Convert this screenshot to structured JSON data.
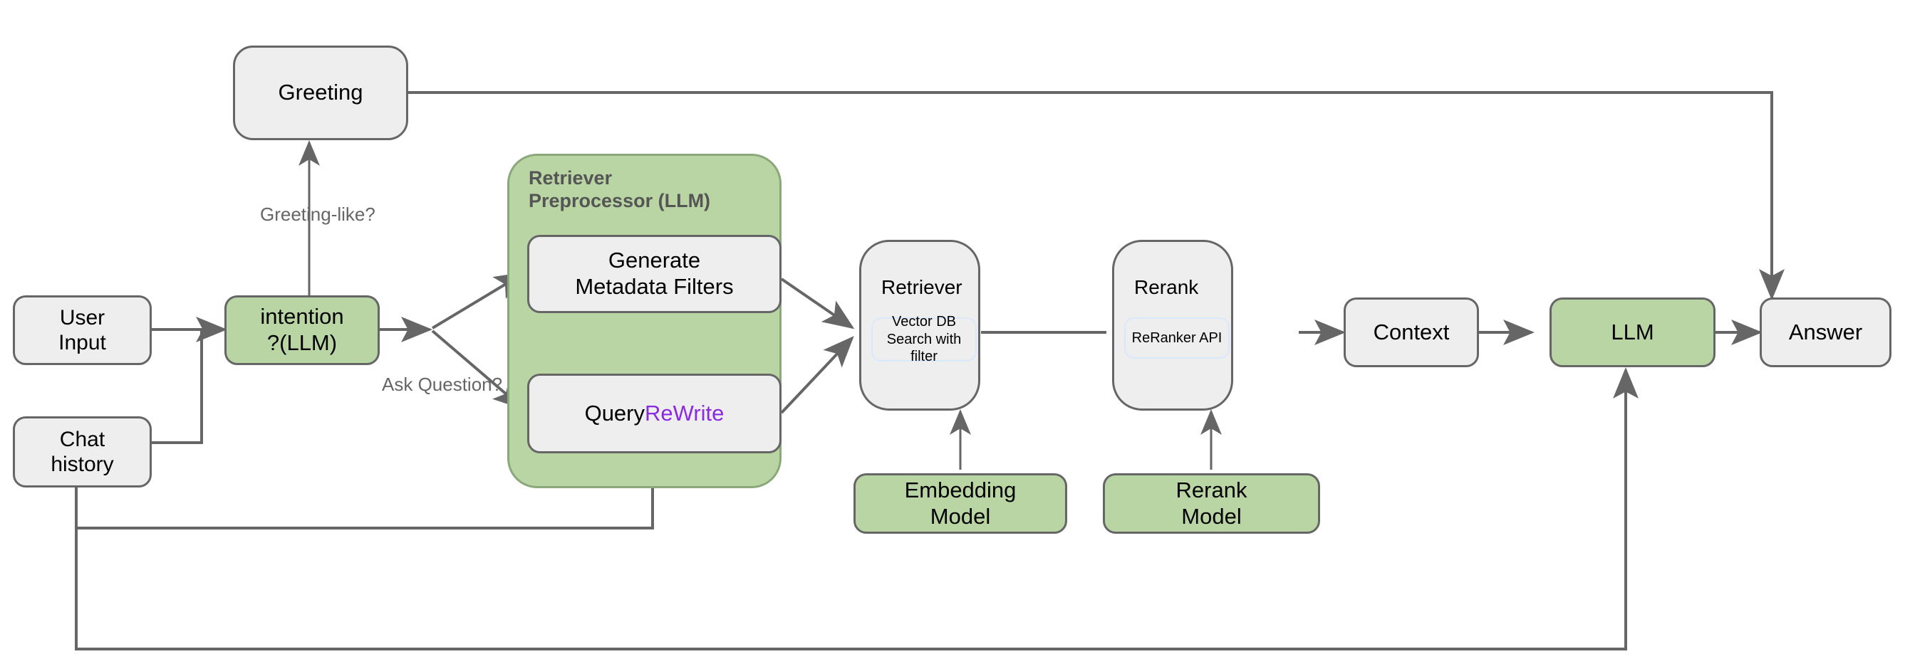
{
  "diagram": {
    "title": "RAG chatbot pipeline flowchart",
    "colors": {
      "green_fill": "#b9d5a4",
      "grey_fill": "#eeeeee",
      "node_stroke": "#666666",
      "edge_stroke": "#666666",
      "edge_label_color": "#666666",
      "group_stroke": "#8aa87a",
      "subbox_stroke": "#dae8fc",
      "accent_purple": "#8a2be2"
    },
    "nodes": {
      "greeting": {
        "label": "Greeting"
      },
      "user_input": {
        "label": "User\nInput"
      },
      "chat_history": {
        "label": "Chat\nhistory"
      },
      "intention": {
        "label": "intention\n?(LLM)"
      },
      "generate_metadata_filters": {
        "label": "Generate\nMetadata Filters"
      },
      "query_rewrite": {
        "prefix": "Query ",
        "accent": "ReWrite"
      },
      "retriever": {
        "label": "Retriever",
        "inner": "Vector DB\nSearch with\nfilter"
      },
      "rerank": {
        "label": "Rerank",
        "inner": "ReRanker API"
      },
      "embedding_model": {
        "label": "Embedding\nModel"
      },
      "rerank_model": {
        "label": "Rerank\nModel"
      },
      "context": {
        "label": "Context"
      },
      "llm": {
        "label": "LLM"
      },
      "answer": {
        "label": "Answer"
      }
    },
    "groups": {
      "retriever_preprocessor": {
        "title": "Retriever\nPreprocessor (LLM)"
      }
    },
    "edge_labels": {
      "greeting_like": "Greeting-like?",
      "ask_question": "Ask Question?"
    }
  }
}
